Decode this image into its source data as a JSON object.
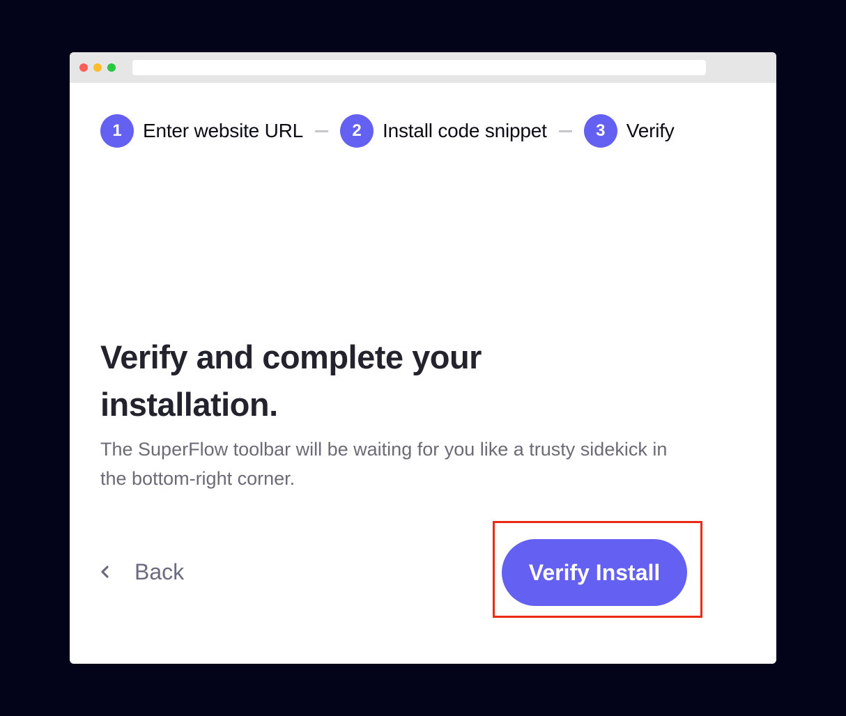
{
  "steps": [
    {
      "number": "1",
      "label": "Enter website URL"
    },
    {
      "number": "2",
      "label": "Install code snippet"
    },
    {
      "number": "3",
      "label": "Verify"
    }
  ],
  "content": {
    "heading": "Verify and complete your installation.",
    "description": "The SuperFlow toolbar will be waiting for you like a trusty sidekick in the bottom-right corner."
  },
  "actions": {
    "back_label": "Back",
    "verify_label": "Verify Install"
  },
  "icons": {
    "back": "chevron-left-icon"
  },
  "colors": {
    "accent": "#6360f2",
    "highlight_border": "#ec2a14",
    "background": "#03031a"
  }
}
